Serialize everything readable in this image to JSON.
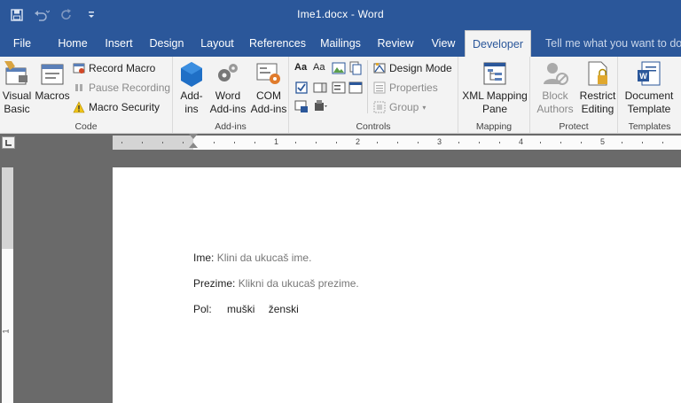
{
  "window": {
    "title": "Ime1.docx  -  Word",
    "qat": {
      "save_icon": "save-icon",
      "undo_icon": "undo-icon",
      "redo_icon": "redo-icon",
      "customize_icon": "customize-qat-icon"
    }
  },
  "tabs": [
    {
      "label": "File"
    },
    {
      "label": "Home"
    },
    {
      "label": "Insert"
    },
    {
      "label": "Design"
    },
    {
      "label": "Layout"
    },
    {
      "label": "References"
    },
    {
      "label": "Mailings"
    },
    {
      "label": "Review"
    },
    {
      "label": "View"
    },
    {
      "label": "Developer",
      "active": true
    }
  ],
  "tell_me": {
    "placeholder": "Tell me what you want to do"
  },
  "ribbon": {
    "code": {
      "label": "Code",
      "visual_basic": "Visual\nBasic",
      "macros": "Macros",
      "record_macro": "Record Macro",
      "pause_recording": "Pause Recording",
      "macro_security": "Macro Security"
    },
    "addins": {
      "label": "Add-ins",
      "addins": "Add-\nins",
      "word_addins": "Word\nAdd-ins",
      "com_addins": "COM\nAdd-ins"
    },
    "controls": {
      "label": "Controls",
      "design_mode": "Design Mode",
      "properties": "Properties",
      "group": "Group"
    },
    "mapping": {
      "label": "Mapping",
      "xml_mapping_pane": "XML Mapping\nPane"
    },
    "protect": {
      "label": "Protect",
      "block_authors": "Block\nAuthors",
      "restrict_editing": "Restrict\nEditing"
    },
    "templates": {
      "label": "Templates",
      "document_template": "Document\nTemplate"
    }
  },
  "ruler": {
    "numbers": [
      "1",
      "2",
      "3",
      "4",
      "5"
    ],
    "vertical_numbers": [
      "1"
    ]
  },
  "document": {
    "fields": [
      {
        "label": "Ime:",
        "placeholder": "Klini da ukucaš ime."
      },
      {
        "label": "Prezime:",
        "placeholder": "Klikni da ukucaš prezime."
      }
    ],
    "gender": {
      "label": "Pol:",
      "options": [
        "muški",
        "ženski"
      ]
    }
  },
  "colors": {
    "title_bar": "#2b579a",
    "ribbon_bg": "#f3f3f3",
    "workspace": "#6a6a6a",
    "placeholder_text": "#777777"
  }
}
